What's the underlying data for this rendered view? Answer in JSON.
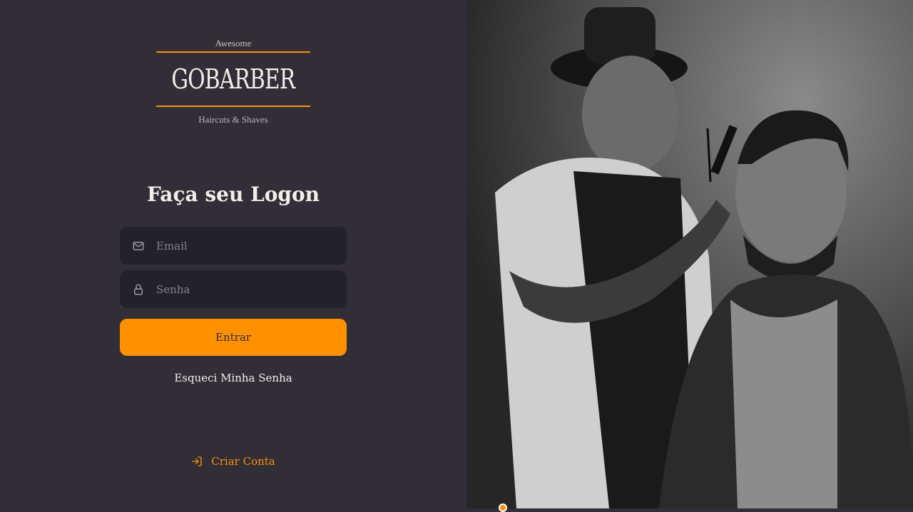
{
  "logo": {
    "top_text": "Awesome",
    "brand": "GOBARBER",
    "bottom_text": "Haircuts & Shaves"
  },
  "form": {
    "title": "Faça seu Logon",
    "email_placeholder": "Email",
    "password_placeholder": "Senha",
    "submit_label": "Entrar",
    "forgot_label": "Esqueci Minha Senha"
  },
  "create_account": {
    "label": "Criar Conta",
    "icon": "log-in-icon"
  },
  "icons": {
    "email": "mail-icon",
    "password": "lock-icon"
  },
  "colors": {
    "background": "#312e38",
    "input_background": "#232129",
    "accent": "#ff9000",
    "text": "#f4ede8",
    "placeholder": "#858289"
  }
}
